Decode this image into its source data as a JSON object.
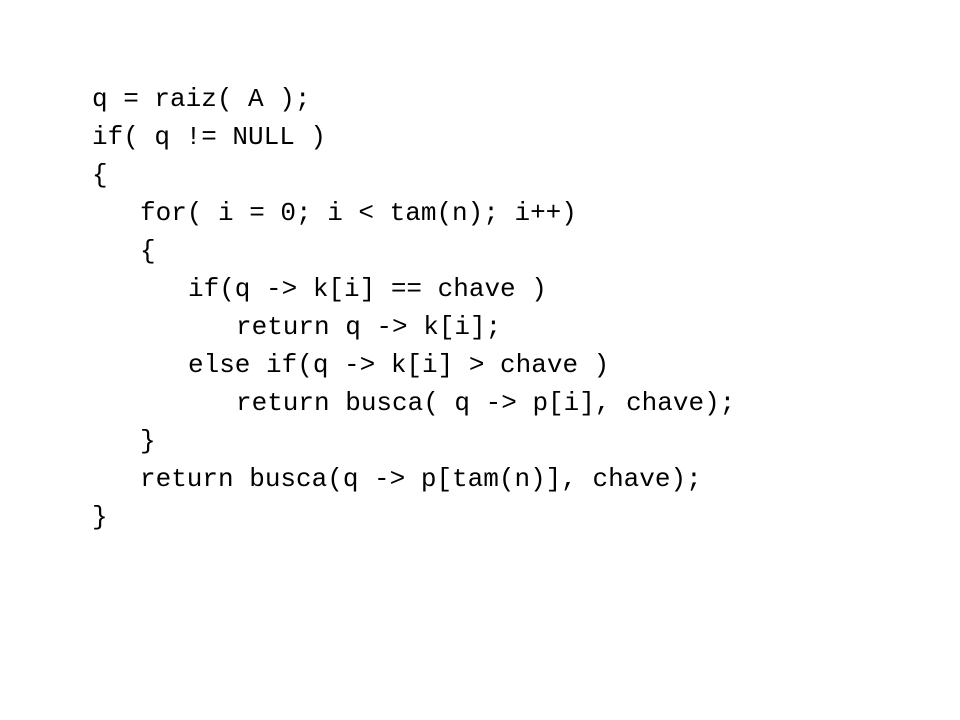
{
  "code": {
    "lines": [
      "q = raiz( A );",
      "if( q != NULL )",
      "{",
      "for( i = 0; i < tam(n); i++)",
      "{",
      "if(q -> k[i] == chave )",
      "return q -> k[i];",
      "else if(q -> k[i] > chave )",
      "return busca( q -> p[i], chave);",
      "}",
      "return busca(q -> p[tam(n)], chave);",
      "}"
    ]
  }
}
